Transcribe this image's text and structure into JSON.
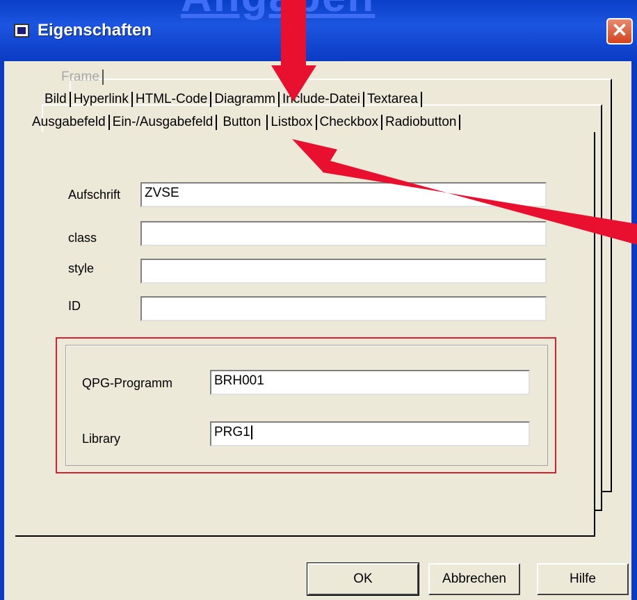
{
  "window": {
    "background_title": "Angaben",
    "title": "Eigenschaften",
    "close_glyph": "✕"
  },
  "tabs": {
    "row1": [
      "Frame"
    ],
    "row2": [
      "Bild",
      "Hyperlink",
      "HTML-Code",
      "Diagramm",
      "Include-Datei",
      "Textarea"
    ],
    "row3": [
      "Ausgabefeld",
      "Ein-/Ausgabefeld",
      "Button",
      "Listbox",
      "Checkbox",
      "Radiobutton"
    ],
    "active": "Button"
  },
  "form": {
    "aufschrift_label": "Aufschrift",
    "aufschrift_value": "ZVSE",
    "class_label": "class",
    "class_value": "",
    "style_label": "style",
    "style_value": "",
    "id_label": "ID",
    "id_value": ""
  },
  "group": {
    "program_label": "QPG-Programm",
    "program_value": "BRH001",
    "library_label": "Library",
    "library_value": "PRG1"
  },
  "buttons": {
    "ok": "OK",
    "cancel": "Abbrechen",
    "help": "Hilfe"
  },
  "colors": {
    "titlebar": "#0b3bc4",
    "annotation_arrow": "#e8102e",
    "highlight_box": "#d8202e"
  },
  "icons": {
    "title": "window-icon",
    "close": "close-icon",
    "arrows": "annotation-arrow"
  }
}
